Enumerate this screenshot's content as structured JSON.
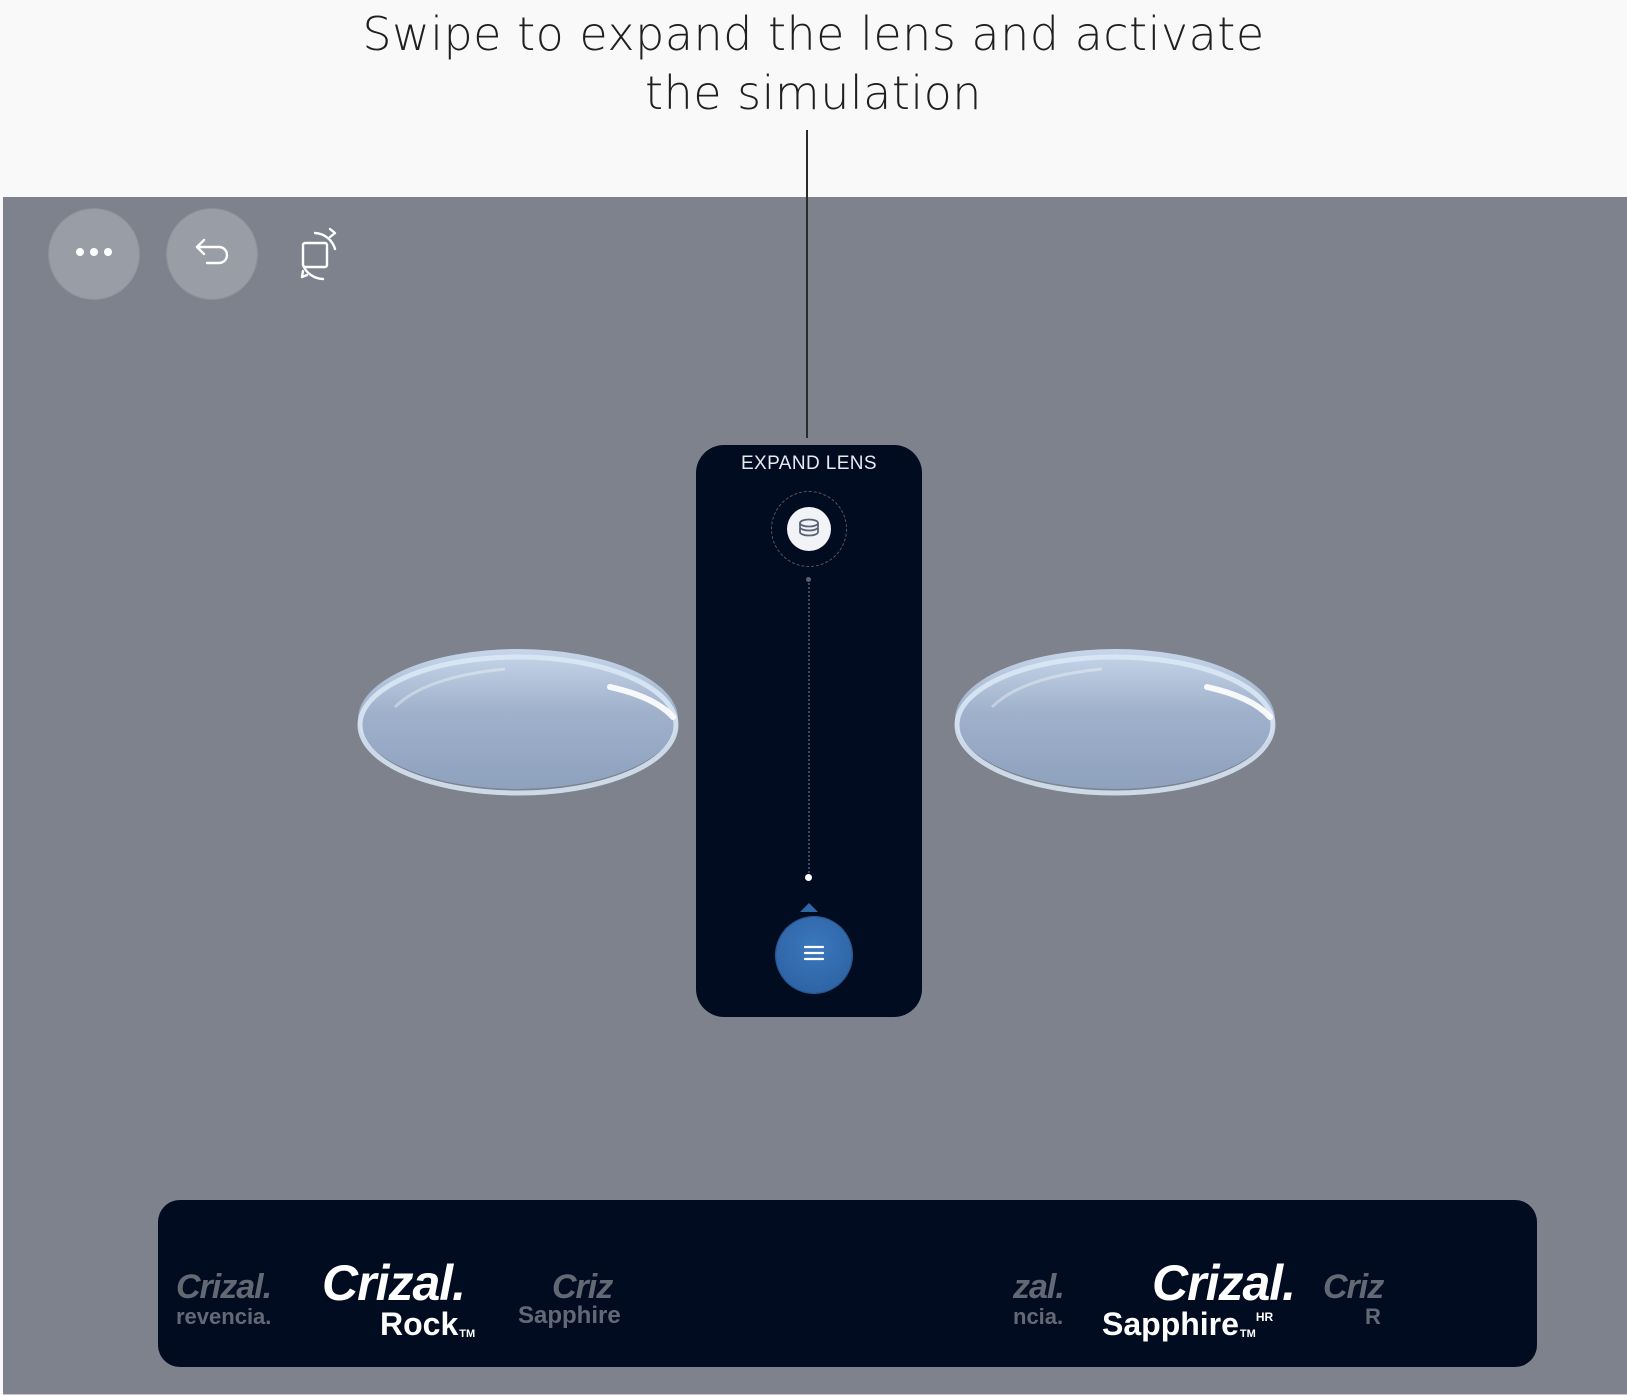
{
  "annotation": {
    "line1": "Swipe to expand the lens and activate",
    "line2": "the simulation"
  },
  "toolbar": {
    "more_icon": "ellipsis-icon",
    "undo_icon": "undo-arrow-icon",
    "rotate_icon": "rotate-device-icon"
  },
  "panel": {
    "title": "EXPAND LENS",
    "top_icon": "lens-stack-icon",
    "knob_icon": "menu-lines-icon"
  },
  "carousel": {
    "items": [
      {
        "brand": "Crizal",
        "sub": "Prevencia",
        "visible_brand": "Crizal.",
        "visible_sub": "revencia."
      },
      {
        "brand": "Crizal",
        "sub": "Rock",
        "visible_brand": "Crizal.",
        "visible_sub": "Rock",
        "tm": "TM"
      },
      {
        "brand": "Crizal",
        "sub": "Sapphire",
        "visible_brand": "Criz",
        "visible_sub": "Sapphire"
      },
      {
        "brand": "Crizal",
        "sub": "Prevencia",
        "visible_brand": "zal.",
        "visible_sub": "ncia."
      },
      {
        "brand": "Crizal",
        "sub": "Sapphire HR",
        "visible_brand": "Crizal.",
        "visible_sub": "Sapphire",
        "tm": "TM",
        "sup": "HR"
      },
      {
        "brand": "Crizal",
        "sub": "Rock",
        "visible_brand": "Criz",
        "visible_sub": "R"
      }
    ]
  },
  "colors": {
    "background": "#7d828d",
    "panel": "#020c20",
    "accent": "#2e66a8"
  }
}
